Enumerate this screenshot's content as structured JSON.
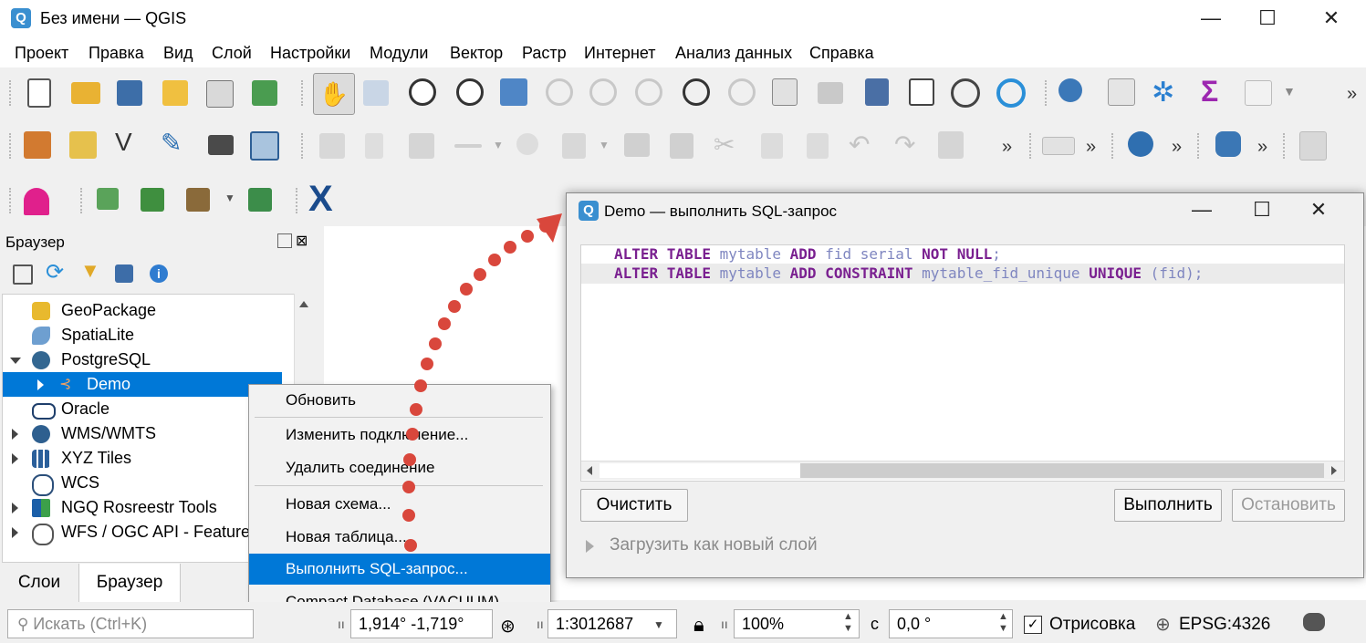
{
  "window": {
    "title": "Без имени — QGIS",
    "controls": {
      "minimize": "—",
      "maximize": "☐",
      "close": "✕"
    }
  },
  "menu": [
    "Проект",
    "Правка",
    "Вид",
    "Слой",
    "Настройки",
    "Модули",
    "Вектор",
    "Растр",
    "Интернет",
    "Анализ данных",
    "Справка"
  ],
  "toolbar": {
    "more": "»"
  },
  "browser_panel": {
    "title": "Браузер",
    "items": [
      {
        "label": "GeoPackage",
        "icon": "geopackage-icon"
      },
      {
        "label": "SpatiaLite",
        "icon": "spatialite-icon"
      },
      {
        "label": "PostgreSQL",
        "icon": "postgresql-icon"
      },
      {
        "label": "Demo",
        "icon": "connection-icon"
      },
      {
        "label": "Oracle",
        "icon": "oracle-icon"
      },
      {
        "label": "WMS/WMTS",
        "icon": "wms-icon"
      },
      {
        "label": "XYZ Tiles",
        "icon": "xyz-tiles-icon"
      },
      {
        "label": "WCS",
        "icon": "wcs-icon"
      },
      {
        "label": "NGQ Rosreestr Tools",
        "icon": "rosreestr-icon"
      },
      {
        "label": "WFS / OGC API - Features",
        "icon": "wfs-icon"
      }
    ]
  },
  "tabs": [
    "Слои",
    "Браузер"
  ],
  "context_menu": [
    "Обновить",
    "Изменить подключение...",
    "Удалить соединение",
    "Новая схема...",
    "Новая таблица...",
    "Выполнить SQL-запрос...",
    "Compact Database (VACUUM)"
  ],
  "status": {
    "search_placeholder": "Искать (Ctrl+K)",
    "coordinate": "1,914° -1,719°",
    "scale": "1:3012687",
    "magnifier": "100%",
    "rotation_label": "с",
    "rotation": "0,0 °",
    "render_label": "Отрисовка",
    "crs": "EPSG:4326"
  },
  "dialog": {
    "title": "Demo — выполнить SQL-запрос",
    "sql_lines": [
      [
        {
          "t": "ALTER TABLE ",
          "c": "kw"
        },
        {
          "t": "mytable ",
          "c": "id"
        },
        {
          "t": "ADD ",
          "c": "kw"
        },
        {
          "t": "fid serial ",
          "c": "id"
        },
        {
          "t": "NOT NULL",
          "c": "kw"
        },
        {
          "t": ";",
          "c": "id"
        }
      ],
      [
        {
          "t": "ALTER TABLE ",
          "c": "kw"
        },
        {
          "t": "mytable ",
          "c": "id"
        },
        {
          "t": "ADD CONSTRAINT ",
          "c": "kw"
        },
        {
          "t": "mytable_fid_unique ",
          "c": "id"
        },
        {
          "t": "UNIQUE ",
          "c": "kw"
        },
        {
          "t": "(fid);",
          "c": "id"
        }
      ]
    ],
    "clear_button": "Очистить",
    "execute_button": "Выполнить",
    "stop_button": "Остановить",
    "load_layer_label": "Загрузить как новый слой"
  },
  "colors": {
    "selection": "#0078d7",
    "annotation_dots": "#d9473c",
    "sql_keyword": "#7a2090",
    "sql_identifier": "#7f86c0"
  }
}
